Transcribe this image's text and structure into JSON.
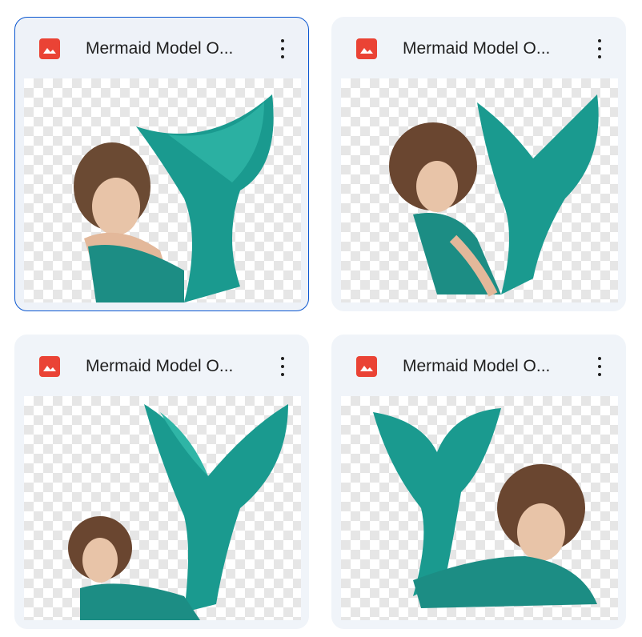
{
  "files": [
    {
      "title": "Mermaid Model O...",
      "file_type_icon": "image-icon",
      "menu_icon": "more-vert-icon",
      "selected": true
    },
    {
      "title": "Mermaid Model O...",
      "file_type_icon": "image-icon",
      "menu_icon": "more-vert-icon",
      "selected": false
    },
    {
      "title": "Mermaid Model O...",
      "file_type_icon": "image-icon",
      "menu_icon": "more-vert-icon",
      "selected": false
    },
    {
      "title": "Mermaid Model O...",
      "file_type_icon": "image-icon",
      "menu_icon": "more-vert-icon",
      "selected": false
    }
  ],
  "colors": {
    "accent": "#0b57d0",
    "image_icon": "#ea4335",
    "card_bg": "#f0f4f9"
  }
}
